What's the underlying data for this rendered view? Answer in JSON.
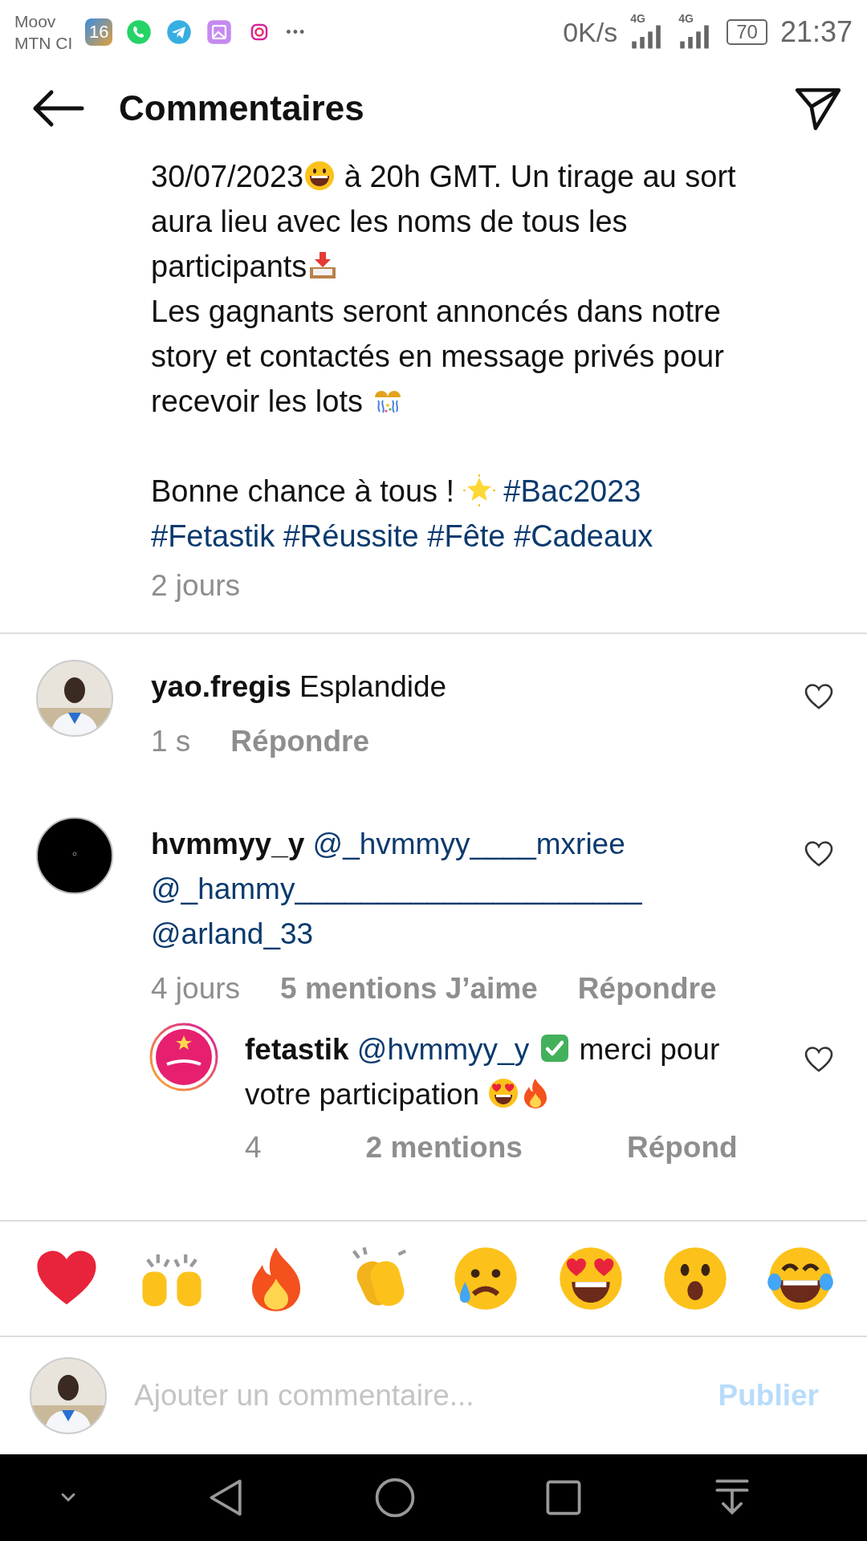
{
  "status_bar": {
    "carrier_1": "Moov",
    "carrier_2": "MTN CI",
    "app_badge": "16",
    "more": "•••",
    "speed": "0K/s",
    "network_1": "4G",
    "network_2": "4G",
    "battery": "70",
    "time": "21:37"
  },
  "header": {
    "title": "Commentaires"
  },
  "caption": {
    "paragraphs": [
      [
        {
          "kind": "text",
          "text": "30/07/2023"
        },
        {
          "kind": "grin"
        },
        {
          "kind": "text",
          "text": " à 20h GMT. Un tirage au sort aura lieu avec les noms de tous les participants"
        },
        {
          "kind": "inbox"
        }
      ],
      [
        {
          "kind": "text",
          "text": "Les gagnants seront annoncés dans notre story et contactés en message privés pour recevoir les lots "
        },
        {
          "kind": "confetti"
        }
      ],
      [
        {
          "kind": "text",
          "text": "Bonne chance à tous ! "
        },
        {
          "kind": "star"
        },
        {
          "kind": "hashtag",
          "text": "#Bac2023"
        },
        {
          "kind": "hashtag",
          "text": "#Fetastik"
        },
        {
          "kind": "hashtag",
          "text": "#Réussite"
        },
        {
          "kind": "hashtag",
          "text": "#Fête"
        },
        {
          "kind": "hashtag",
          "text": "#Cadeaux"
        }
      ]
    ],
    "time": "2 jours"
  },
  "comments": [
    {
      "avatar": {
        "kind": "picture"
      },
      "username": "yao.fregis",
      "parts": [
        {
          "kind": "text",
          "text": " Esplandide"
        }
      ],
      "time": "1 s",
      "reply": "Répondre"
    },
    {
      "avatar": {
        "kind": "picture"
      },
      "username": "hvmmyy_y",
      "parts": [
        {
          "kind": "mention",
          "text": "@_hvmmyy____mxriee"
        },
        {
          "kind": "mention",
          "text": "@_hammy_____________________"
        },
        {
          "kind": "mention",
          "text": "@arland_33"
        }
      ],
      "time": "4 jours",
      "likes": "5 mentions J’aime",
      "reply": "Répondre",
      "replies": [
        {
          "avatar": {
            "kind": "picture"
          },
          "username": "fetastik",
          "parts": [
            {
              "kind": "mention",
              "text": "@hvmmyy_y"
            },
            {
              "kind": "check"
            },
            {
              "kind": "text",
              "text": "  merci pour votre participation "
            },
            {
              "kind": "hearteyes"
            },
            {
              "kind": "fire"
            }
          ],
          "time": "4",
          "likes": "2 mentions",
          "reply": "Répond"
        }
      ]
    }
  ],
  "reactions": [
    {
      "kind": "heart"
    },
    {
      "kind": "raised"
    },
    {
      "kind": "fire"
    },
    {
      "kind": "clap"
    },
    {
      "kind": "cry"
    },
    {
      "kind": "hearteyes"
    },
    {
      "kind": "wow"
    },
    {
      "kind": "joy"
    }
  ],
  "composer": {
    "placeholder": "Ajouter un commentaire...",
    "button": "Publier"
  }
}
